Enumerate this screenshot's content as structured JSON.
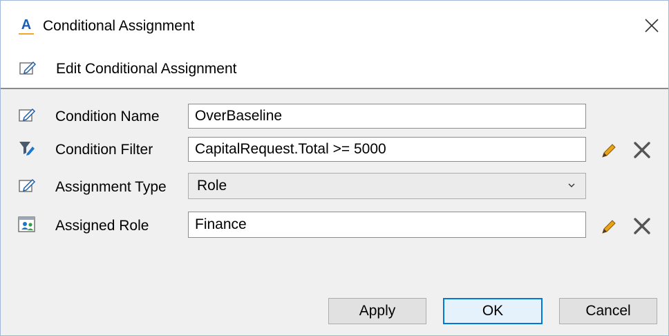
{
  "window": {
    "title": "Conditional Assignment",
    "app_icon_letter": "A",
    "icons": {
      "app": "app-logo-icon",
      "close": "close-icon"
    }
  },
  "subheader": {
    "title": "Edit Conditional Assignment",
    "icon": "edit-form-icon"
  },
  "form": {
    "condition_name": {
      "label": "Condition Name",
      "value": "OverBaseline",
      "icon": "edit-form-icon"
    },
    "condition_filter": {
      "label": "Condition Filter",
      "value": "CapitalRequest.Total >= 5000",
      "icon": "filter-edit-icon"
    },
    "assignment_type": {
      "label": "Assignment Type",
      "value": "Role",
      "icon": "edit-form-icon"
    },
    "assigned_role": {
      "label": "Assigned Role",
      "value": "Finance",
      "icon": "role-users-icon"
    }
  },
  "buttons": {
    "apply": "Apply",
    "ok": "OK",
    "cancel": "Cancel"
  },
  "colors": {
    "accent": "#0078d7",
    "app_icon_letter": "#1a5fb4",
    "app_icon_underline": "#f5a623",
    "content_background": "#f0f0f0",
    "pencil": "#e8a317",
    "clear_x": "#555555"
  }
}
